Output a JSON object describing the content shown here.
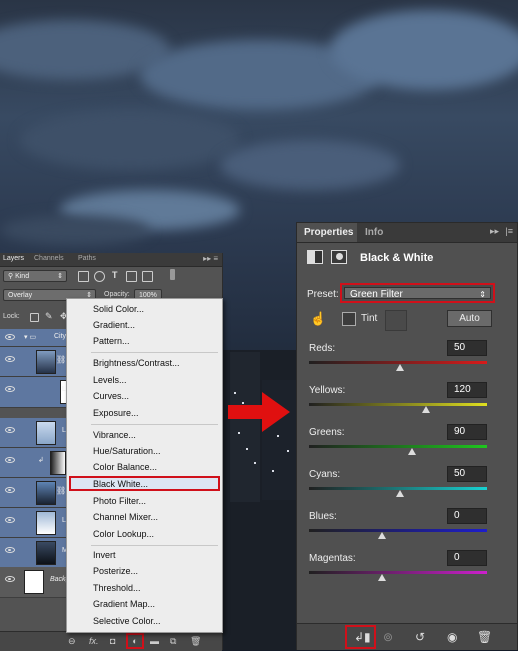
{
  "layers_panel": {
    "tabs": [
      "Layers",
      "Channels",
      "Paths"
    ],
    "filter_kind": "Kind",
    "blend_mode": "Overlay",
    "opacity_label": "Opacity:",
    "opacity_value": "100%",
    "lock_label": "Lock:",
    "layers": [
      {
        "name": "City",
        "visible": true,
        "selected": true
      },
      {
        "name": "",
        "visible": true,
        "selected": true
      },
      {
        "name": "L",
        "visible": true,
        "selected": true
      },
      {
        "name": "",
        "visible": true,
        "selected": true
      },
      {
        "name": "",
        "visible": true,
        "selected": true
      },
      {
        "name": "L",
        "visible": true,
        "selected": true
      },
      {
        "name": "M",
        "visible": true,
        "selected": true
      },
      {
        "name": "Backg",
        "visible": true,
        "selected": false
      }
    ],
    "footer_icons": [
      "link-icon",
      "fx-icon",
      "mask-icon",
      "adjustment-icon",
      "folder-icon",
      "new-layer-icon",
      "trash-icon"
    ]
  },
  "adjustment_menu": {
    "items": [
      "Solid Color...",
      "Gradient...",
      "Pattern...",
      "Brightness/Contrast...",
      "Levels...",
      "Curves...",
      "Exposure...",
      "Vibrance...",
      "Hue/Saturation...",
      "Color Balance...",
      "Black  White...",
      "Photo Filter...",
      "Channel Mixer...",
      "Color Lookup...",
      "Invert",
      "Posterize...",
      "Threshold...",
      "Gradient Map...",
      "Selective Color..."
    ],
    "highlighted": "Black  White..."
  },
  "properties_panel": {
    "tabs": [
      "Properties",
      "Info"
    ],
    "title": "Black & White",
    "preset_label": "Preset:",
    "preset_value": "Green Filter",
    "tint_label": "Tint",
    "auto_label": "Auto",
    "sliders": [
      {
        "label": "Reds:",
        "value": "50",
        "fraction": 0.51,
        "gradient": "linear-gradient(90deg,#202020,#d81b1b)"
      },
      {
        "label": "Yellows:",
        "value": "120",
        "fraction": 0.66,
        "gradient": "linear-gradient(90deg,#202020,#e0e020)"
      },
      {
        "label": "Greens:",
        "value": "90",
        "fraction": 0.58,
        "gradient": "linear-gradient(90deg,#202020,#1ec81e)"
      },
      {
        "label": "Cyans:",
        "value": "50",
        "fraction": 0.51,
        "gradient": "linear-gradient(90deg,#202020,#18d2d2)"
      },
      {
        "label": "Blues:",
        "value": "0",
        "fraction": 0.41,
        "gradient": "linear-gradient(90deg,#202020,#1d1dcc)"
      },
      {
        "label": "Magentas:",
        "value": "0",
        "fraction": 0.41,
        "gradient": "linear-gradient(90deg,#202020,#cc20cc)"
      }
    ],
    "footer_icons": [
      "clip-to-layer-icon",
      "view-previous-icon",
      "reset-icon",
      "visibility-icon",
      "trash-icon"
    ]
  },
  "colors": {
    "highlight_red": "#d0101a",
    "layer_selected": "#5e77a0",
    "panel_bg": "#505050"
  }
}
